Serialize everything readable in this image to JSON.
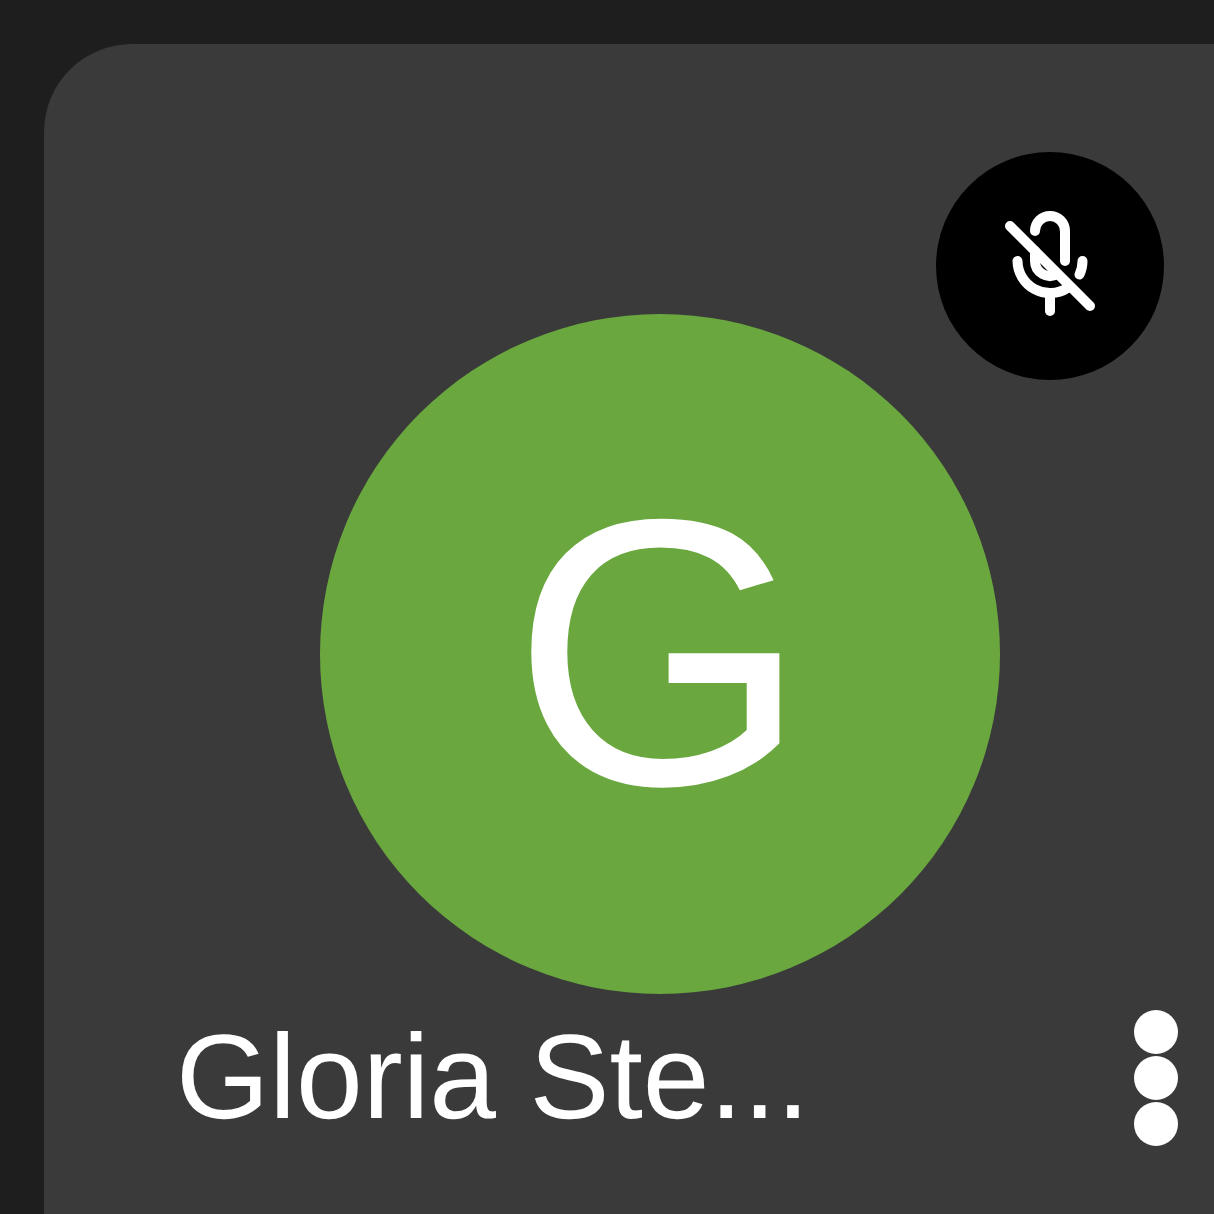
{
  "participant": {
    "initial": "G",
    "name": "Gloria Ste...",
    "muted": true
  }
}
